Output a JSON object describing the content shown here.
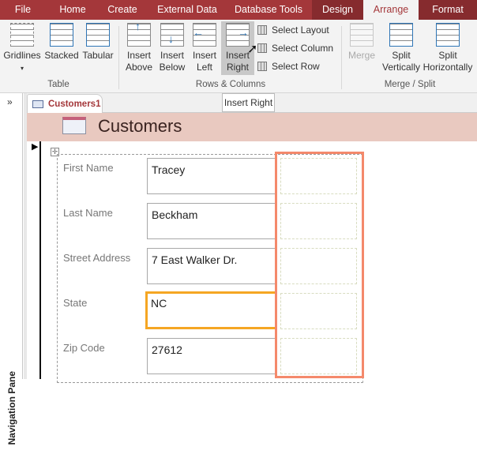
{
  "menu_tabs": [
    "File",
    "Home",
    "Create",
    "External Data",
    "Database Tools",
    "Design",
    "Arrange",
    "Format"
  ],
  "ribbon": {
    "table_group": {
      "label": "Table",
      "buttons": [
        "Gridlines",
        "Stacked",
        "Tabular"
      ]
    },
    "rows_columns_group": {
      "label": "Rows & Columns",
      "buttons": [
        [
          "Insert",
          "Above"
        ],
        [
          "Insert",
          "Below"
        ],
        [
          "Insert",
          "Left"
        ],
        [
          "Insert",
          "Right"
        ]
      ],
      "small": [
        "Select Layout",
        "Select Column",
        "Select Row"
      ]
    },
    "merge_group": {
      "label": "Merge / Split",
      "buttons": [
        [
          "Merge",
          ""
        ],
        [
          "Split",
          "Vertically"
        ],
        [
          "Split",
          "Horizontally"
        ]
      ]
    }
  },
  "tooltip": "Insert Right",
  "nav_toggle": "»",
  "nav_label": "Navigation Pane",
  "document_tab": "Customers1",
  "form": {
    "title": "Customers",
    "fields": [
      {
        "label": "First Name",
        "value": "Tracey"
      },
      {
        "label": "Last Name",
        "value": "Beckham"
      },
      {
        "label": "Street Address",
        "value": "7 East Walker Dr."
      },
      {
        "label": "State",
        "value": "NC"
      },
      {
        "label": "Zip Code",
        "value": "27612"
      }
    ]
  },
  "colors": {
    "accent": "#a4373a",
    "highlight": "#f5a623",
    "selection": "#f4896b"
  }
}
